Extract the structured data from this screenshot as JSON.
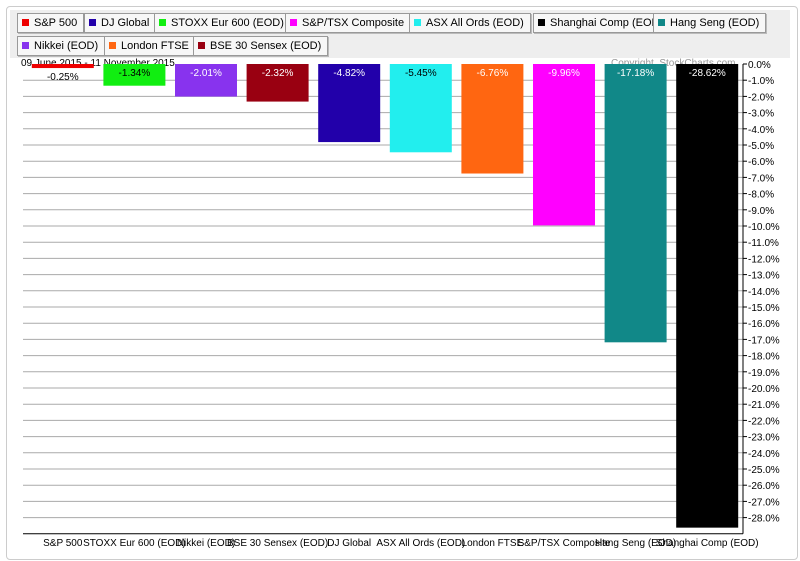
{
  "legend": [
    {
      "label": "S&P 500",
      "color": "#ee0000"
    },
    {
      "label": "DJ Global",
      "color": "#2200aa"
    },
    {
      "label": "STOXX Eur 600 (EOD)",
      "color": "#11ee11"
    },
    {
      "label": "S&P/TSX Composite",
      "color": "#ff00ff"
    },
    {
      "label": "ASX All Ords (EOD)",
      "color": "#22eeee"
    },
    {
      "label": "Shanghai Comp (EOD)",
      "color": "#000000"
    },
    {
      "label": "Hang Seng (EOD)",
      "color": "#118888"
    },
    {
      "label": "Nikkei (EOD)",
      "color": "#8833ee"
    },
    {
      "label": "London FTSE",
      "color": "#ff6611"
    },
    {
      "label": "BSE 30 Sensex (EOD)",
      "color": "#990011"
    }
  ],
  "date_range": "09 June 2015 - 11 November 2015",
  "copyright": "Copyright, StockCharts.com",
  "chart_data": {
    "type": "bar",
    "categories": [
      "S&P 500",
      "STOXX Eur 600 (EOD)",
      "Nikkei (EOD)",
      "BSE 30 Sensex (EOD)",
      "DJ Global",
      "ASX All Ords (EOD)",
      "London FTSE",
      "S&P/TSX Composite",
      "Hang Seng (EOD)",
      "Shanghai Comp (EOD)"
    ],
    "values": [
      -0.25,
      -1.34,
      -2.01,
      -2.32,
      -4.82,
      -5.45,
      -6.76,
      -9.96,
      -17.18,
      -28.62
    ],
    "value_labels": [
      "-0.25%",
      "-1.34%",
      "-2.01%",
      "-2.32%",
      "-4.82%",
      "-5.45%",
      "-6.76%",
      "-9.96%",
      "-17.18%",
      "-28.62%"
    ],
    "colors": [
      "#ee0000",
      "#11ee11",
      "#8833ee",
      "#990011",
      "#2200aa",
      "#22eeee",
      "#ff6611",
      "#ff00ff",
      "#118888",
      "#000000"
    ],
    "label_colors": [
      "#000",
      "#000",
      "#fff",
      "#fff",
      "#fff",
      "#000",
      "#fff",
      "#fff",
      "#fff",
      "#fff"
    ],
    "ylim": [
      -29,
      0
    ],
    "yticks": [
      0,
      -1,
      -2,
      -3,
      -4,
      -5,
      -6,
      -7,
      -8,
      -9,
      -10,
      -11,
      -12,
      -13,
      -14,
      -15,
      -16,
      -17,
      -18,
      -19,
      -20,
      -21,
      -22,
      -23,
      -24,
      -25,
      -26,
      -27,
      -28
    ],
    "ytick_labels": [
      "0.0%",
      "-1.0%",
      "-2.0%",
      "-3.0%",
      "-4.0%",
      "-5.0%",
      "-6.0%",
      "-7.0%",
      "-8.0%",
      "-9.0%",
      "-10.0%",
      "-11.0%",
      "-12.0%",
      "-13.0%",
      "-14.0%",
      "-15.0%",
      "-16.0%",
      "-17.0%",
      "-18.0%",
      "-19.0%",
      "-20.0%",
      "-21.0%",
      "-22.0%",
      "-23.0%",
      "-24.0%",
      "-25.0%",
      "-26.0%",
      "-27.0%",
      "-28.0%"
    ],
    "grid": true,
    "yaxis_side": "right"
  }
}
